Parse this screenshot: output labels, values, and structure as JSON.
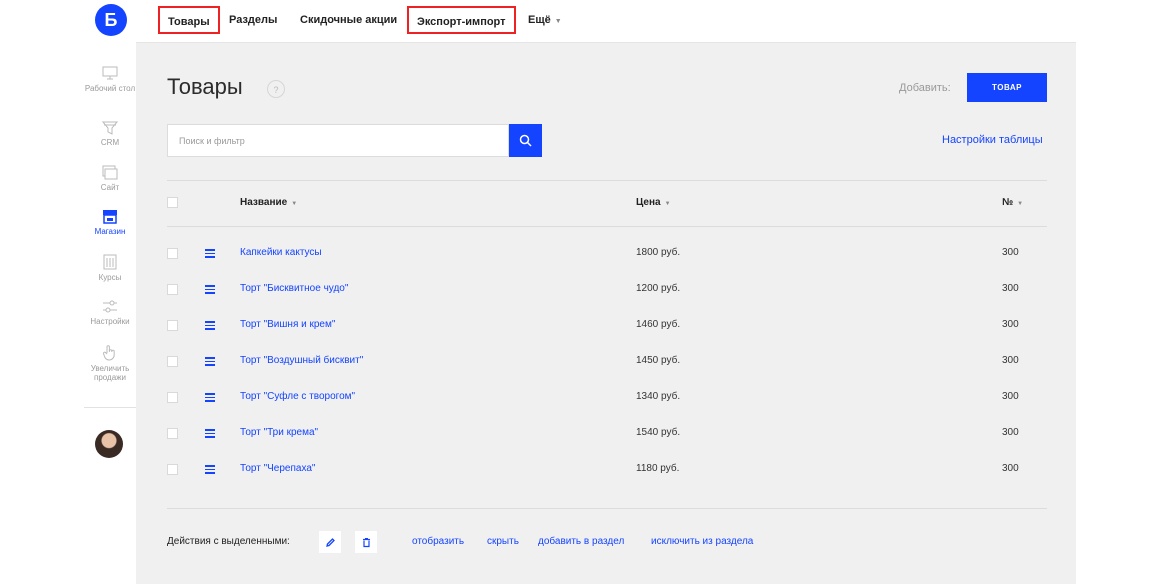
{
  "logo": "Б",
  "rail": [
    {
      "label": "Рабочий стол",
      "icon": "monitor-icon"
    },
    {
      "label": "CRM",
      "icon": "funnel-icon"
    },
    {
      "label": "Сайт",
      "icon": "site-icon"
    },
    {
      "label": "Магазин",
      "icon": "shop-icon",
      "active": true
    },
    {
      "label": "Курсы",
      "icon": "courses-icon"
    },
    {
      "label": "Настройки",
      "icon": "sliders-icon"
    },
    {
      "label": "Увеличить продажи",
      "icon": "hand-icon"
    }
  ],
  "nav": {
    "items": [
      "Товары",
      "Разделы",
      "Скидочные акции",
      "Экспорт-импорт",
      "Ещё"
    ]
  },
  "page": {
    "title": "Товары",
    "help": "?",
    "add_label": "Добавить:",
    "add_button": "ТОВАР",
    "search_placeholder": "Поиск и фильтр",
    "table_settings": "Настройки таблицы"
  },
  "table": {
    "headers": {
      "name": "Название",
      "price": "Цена",
      "num": "№"
    },
    "rows": [
      {
        "name": "Капкейки кактусы",
        "price": "1800 руб.",
        "num": "300"
      },
      {
        "name": "Торт \"Бисквитное чудо\"",
        "price": "1200 руб.",
        "num": "300"
      },
      {
        "name": "Торт \"Вишня и крем\"",
        "price": "1460 руб.",
        "num": "300"
      },
      {
        "name": "Торт \"Воздушный бисквит\"",
        "price": "1450 руб.",
        "num": "300"
      },
      {
        "name": "Торт \"Суфле с творогом\"",
        "price": "1340 руб.",
        "num": "300"
      },
      {
        "name": "Торт \"Три крема\"",
        "price": "1540 руб.",
        "num": "300"
      },
      {
        "name": "Торт \"Черепаха\"",
        "price": "1180 руб.",
        "num": "300"
      }
    ]
  },
  "actions": {
    "label": "Действия с выделенными:",
    "links": [
      "отобразить",
      "скрыть",
      "добавить в раздел",
      "исключить из раздела"
    ]
  },
  "colors": {
    "accent": "#1444ff",
    "highlight": "#ee2222",
    "panel": "#f0f0f0"
  }
}
